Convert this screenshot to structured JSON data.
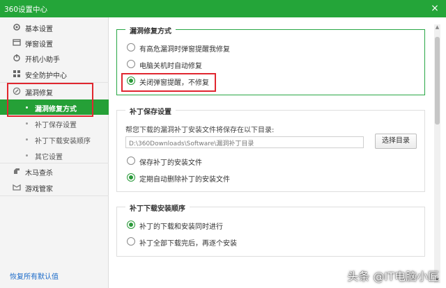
{
  "window": {
    "title": "360设置中心",
    "close_glyph": "×"
  },
  "sidebar": {
    "items": [
      {
        "label": "基本设置",
        "icon": "gear-icon"
      },
      {
        "label": "弹窗设置",
        "icon": "popup-icon"
      },
      {
        "label": "开机小助手",
        "icon": "assistant-icon"
      },
      {
        "label": "安全防护中心",
        "icon": "shield-grid-icon"
      },
      {
        "label": "漏洞修复",
        "icon": "repair-icon"
      },
      {
        "label": "木马查杀",
        "icon": "trojan-icon"
      },
      {
        "label": "游戏管家",
        "icon": "game-icon"
      }
    ],
    "subitems": [
      {
        "label": "漏洞修复方式",
        "active": true
      },
      {
        "label": "补丁保存设置",
        "active": false
      },
      {
        "label": "补丁下载安装顺序",
        "active": false
      },
      {
        "label": "其它设置",
        "active": false
      }
    ],
    "restore_label": "恢复所有默认值"
  },
  "main": {
    "repair_mode": {
      "title": "漏洞修复方式",
      "options": [
        {
          "label": "有高危漏洞时弹窗提醒我修复",
          "checked": false
        },
        {
          "label": "电脑关机时自动修复",
          "checked": false
        },
        {
          "label": "关闭弹窗提醒，不修复",
          "checked": true
        }
      ]
    },
    "patch_save": {
      "title": "补丁保存设置",
      "description": "帮您下载的漏洞补丁安装文件将保存在以下目录:",
      "path": "D:\\360Downloads\\Software\\漏洞补丁目录",
      "browse_label": "选择目录",
      "options": [
        {
          "label": "保存补丁的安装文件",
          "checked": false
        },
        {
          "label": "定期自动删除补丁的安装文件",
          "checked": true
        }
      ]
    },
    "download_order": {
      "title": "补丁下载安装顺序",
      "options": [
        {
          "label": "补丁的下载和安装同时进行",
          "checked": true
        },
        {
          "label": "补丁全部下载完后，再逐个安装",
          "checked": false
        }
      ]
    }
  },
  "watermark": "头条 @IT电脑小匠",
  "colors": {
    "brand_green": "#24a539",
    "annotation_red": "#e0262f",
    "link_blue": "#1a6ac9"
  }
}
